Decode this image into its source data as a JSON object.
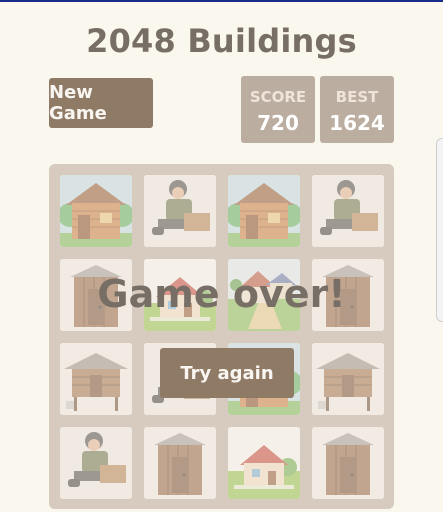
{
  "header": {
    "title": "2048 Buildings"
  },
  "controls": {
    "new_game_label": "New Game"
  },
  "scores": {
    "score_label": "SCORE",
    "score_value": "720",
    "best_label": "BEST",
    "best_value": "1624"
  },
  "board": {
    "rows": [
      [
        "wooden-hut",
        "sitting-man",
        "wooden-hut",
        "sitting-man"
      ],
      [
        "outhouse-shack",
        "red-roof-house",
        "village-house",
        "outhouse-shack"
      ],
      [
        "stilt-shed",
        "sitting-man",
        "wooden-hut",
        "stilt-shed"
      ],
      [
        "sitting-man",
        "outhouse-shack",
        "red-roof-house",
        "outhouse-shack"
      ]
    ]
  },
  "overlay": {
    "message": "Game over!",
    "try_again_label": "Try again"
  },
  "colors": {
    "background": "#faf7ee",
    "board": "#bbada0",
    "button": "#8f7a66",
    "title_text": "#776e65"
  }
}
